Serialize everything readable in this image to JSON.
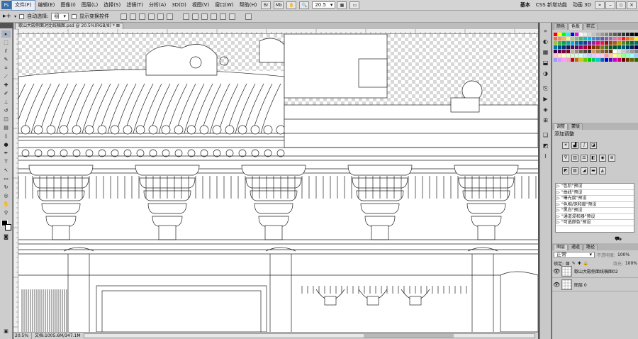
{
  "menubar": {
    "items": [
      "文件(F)",
      "编辑(E)",
      "图像(I)",
      "图层(L)",
      "选择(S)",
      "滤镜(T)",
      "分析(A)",
      "3D(D)",
      "视图(V)",
      "窗口(W)",
      "帮助(H)"
    ],
    "zoom_value": "20.5",
    "workspaces": [
      "基本",
      "CSS 新增功能",
      "动画 3D"
    ],
    "more": "»"
  },
  "options": {
    "auto_select_label": "自动选择:",
    "auto_select_value": "组",
    "show_transform_label": "显示变换控件"
  },
  "document": {
    "tab_title": "歇山大殿侧面对比线稿图.psd @ 20.5%(RGB/8) *"
  },
  "status": {
    "zoom": "20.5%",
    "doc_info": "文档:1005.6M/347.1M"
  },
  "swatches": {
    "tabs": [
      "颜色",
      "色板",
      "样式"
    ],
    "colors": [
      "#ff0000",
      "#ffff00",
      "#00ff00",
      "#00ffff",
      "#0000ff",
      "#ff00ff",
      "#ffffff",
      "#ebebeb",
      "#d6d6d6",
      "#c2c2c2",
      "#adadad",
      "#999999",
      "#858585",
      "#707070",
      "#5c5c5c",
      "#474747",
      "#333333",
      "#1f1f1f",
      "#0a0a0a",
      "#000000",
      "#f26c4f",
      "#f68e55",
      "#fbaf5c",
      "#fff467",
      "#acd372",
      "#7cc576",
      "#3bb878",
      "#1abbb4",
      "#00bff3",
      "#438ccb",
      "#5574b9",
      "#605ca8",
      "#855fa8",
      "#a763a9",
      "#ef6ea8",
      "#f16d7e",
      "#ee1d24",
      "#f16522",
      "#f7941d",
      "#fff100",
      "#8fc63d",
      "#37b44a",
      "#00a650",
      "#00a99e",
      "#00aeef",
      "#0072bc",
      "#0054a5",
      "#2f3192",
      "#652c91",
      "#91278f",
      "#ed008c",
      "#ee105a",
      "#9d0a0f",
      "#a1410d",
      "#a36209",
      "#aba000",
      "#588528",
      "#197b30",
      "#007236",
      "#00736a",
      "#0076a4",
      "#004a80",
      "#003370",
      "#1d1363",
      "#450e61",
      "#62055f",
      "#9e005c",
      "#9d0039",
      "#790000",
      "#7b3000",
      "#7c4900",
      "#827a00",
      "#3e6617",
      "#045f20",
      "#005824",
      "#005951",
      "#005b7e",
      "#003562",
      "#002056",
      "#0c004b",
      "#30004a",
      "#4b0048",
      "#7a0045",
      "#7a0026",
      "#c7b299",
      "#998675",
      "#736357",
      "#534741",
      "#362f2d",
      "#c69c6d",
      "#a67c52",
      "#8c6239",
      "#754c24",
      "#603913",
      "#ffffff",
      "#e6e6e6",
      "#cccccc",
      "#b3b3b3",
      "#999999",
      "#808080",
      "#ffcccc",
      "#ffe5cc",
      "#ffffcc",
      "#e5ffcc",
      "#ccffcc",
      "#ccffe5",
      "#ccffff",
      "#cce5ff",
      "#ccccff",
      "#e5ccff",
      "#ffccff",
      "#ffcce5",
      "#ff9999",
      "#ffcc99",
      "#ffff99",
      "#ccff99",
      "#99ff99",
      "#99ffcc",
      "#99ffff",
      "#99ccff",
      "#9999ff",
      "#cc99ff",
      "#ff99ff",
      "#ff99cc",
      "#cc0000",
      "#cc6600",
      "#cccc00",
      "#66cc00",
      "#00cc00",
      "#00cc66",
      "#00cccc",
      "#0066cc",
      "#0000cc",
      "#6600cc",
      "#cc00cc",
      "#cc0066",
      "#660000",
      "#663300",
      "#666600",
      "#336600"
    ]
  },
  "adjustments": {
    "tabs": [
      "调整",
      "蒙版"
    ],
    "title": "添加调整",
    "presets": [
      "\"色阶\"预设",
      "\"曲线\"预设",
      "\"曝光度\"预设",
      "\"色相/饱和度\"预设",
      "\"黑白\"预设",
      "\"通道混和器\"预设",
      "\"可选颜色\"预设"
    ]
  },
  "layers": {
    "tabs": [
      "图层",
      "通道",
      "路径"
    ],
    "blend_mode": "正常",
    "opacity_label": "不透明度:",
    "opacity_value": "100%",
    "lock_label": "锁定:",
    "fill_label": "填充:",
    "fill_value": "100%",
    "items": [
      {
        "name": "歇山大殿侧面线稿图02",
        "visible": true
      },
      {
        "name": "图层 0",
        "visible": true
      }
    ]
  }
}
